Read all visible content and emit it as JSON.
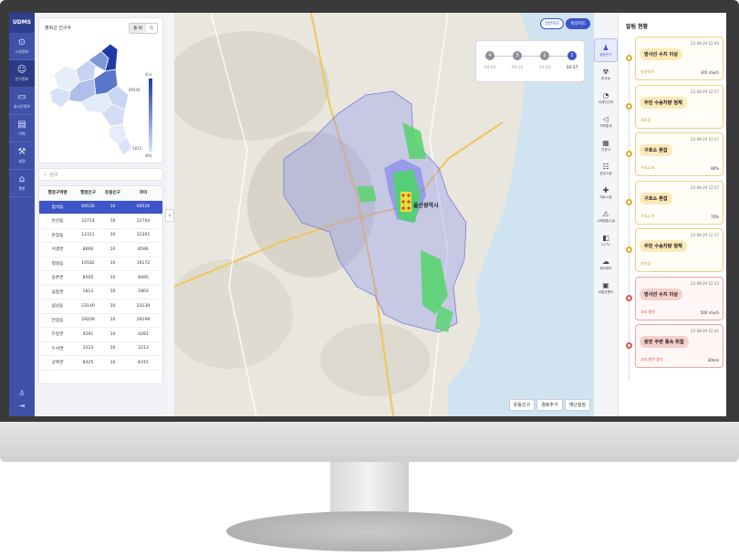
{
  "app": {
    "logo": "UDMS"
  },
  "nav": [
    {
      "icon": "map-pin-icon",
      "glyph": "⊙",
      "label": "시설정보"
    },
    {
      "icon": "person-icon",
      "glyph": "☺",
      "label": "인구정보"
    },
    {
      "icon": "monitor-icon",
      "glyph": "▭",
      "label": "실시간정보"
    },
    {
      "icon": "book-icon",
      "glyph": "▤",
      "label": "이력"
    },
    {
      "icon": "tools-icon",
      "glyph": "⚒",
      "label": "설정"
    },
    {
      "icon": "robot-icon",
      "glyph": "⌂",
      "label": "챗봇"
    }
  ],
  "population": {
    "title": "출퇴근 인구수",
    "toggle": [
      "출·퇴",
      "각"
    ],
    "legend_max_label": "최고",
    "legend_max": "69536",
    "legend_min": "1813",
    "legend_min_label": "최저"
  },
  "search": {
    "placeholder": "검색"
  },
  "table": {
    "headers": [
      "행정구역명",
      "행정인구",
      "유동인구",
      "차이"
    ],
    "rows": [
      [
        "범서읍",
        "69536",
        "10",
        "69526"
      ],
      [
        "온산읍",
        "22714",
        "10",
        "22704"
      ],
      [
        "온양읍",
        "12311",
        "10",
        "12301"
      ],
      [
        "서생면",
        "8606",
        "10",
        "8596"
      ],
      [
        "청량읍",
        "19182",
        "10",
        "19172"
      ],
      [
        "웅촌면",
        "8505",
        "10",
        "8495"
      ],
      [
        "삼동면",
        "1813",
        "10",
        "1803"
      ],
      [
        "삼남읍",
        "23140",
        "10",
        "23130"
      ],
      [
        "언양읍",
        "29209",
        "10",
        "29199"
      ],
      [
        "두동면",
        "4291",
        "10",
        "4281"
      ],
      [
        "두서면",
        "3223",
        "10",
        "3213"
      ],
      [
        "상북면",
        "8325",
        "10",
        "8315"
      ]
    ]
  },
  "map": {
    "basemap_buttons": [
      "일반지도",
      "위성지도"
    ],
    "city_label": "울산광역시",
    "timeline": [
      {
        "n": "4",
        "time": "09:03"
      },
      {
        "n": "3",
        "time": "09:32"
      },
      {
        "n": "2",
        "time": "10:03"
      },
      {
        "n": "1",
        "time": "10:37"
      }
    ],
    "bottom_buttons": [
      "유동인구",
      "경로추가",
      "재난설정"
    ]
  },
  "tools": [
    {
      "icon": "people-icon",
      "glyph": "♟",
      "label": "유동인구"
    },
    {
      "icon": "radiation-icon",
      "glyph": "☢",
      "label": "방사능"
    },
    {
      "icon": "gauge-icon",
      "glyph": "◔",
      "label": "이재민관리"
    },
    {
      "icon": "megaphone-icon",
      "glyph": "◁",
      "label": "지휘통제"
    },
    {
      "icon": "building-icon",
      "glyph": "▦",
      "label": "관공서"
    },
    {
      "icon": "group-icon",
      "glyph": "☷",
      "label": "공공시설"
    },
    {
      "icon": "hospital-icon",
      "glyph": "✚",
      "label": "의료시설"
    },
    {
      "icon": "hazard-icon",
      "glyph": "⚠",
      "label": "시해위험시설"
    },
    {
      "icon": "cctv-icon",
      "glyph": "◧",
      "label": "CCTV"
    },
    {
      "icon": "weather-icon",
      "glyph": "☁",
      "label": "위치정보"
    },
    {
      "icon": "car-icon",
      "glyph": "▣",
      "label": "교통흐름도"
    }
  ],
  "alerts": {
    "title": "알림 현황",
    "items": [
      {
        "time": "22-08-29 12:40",
        "title": "방사선 수치 이상",
        "location": "길지역 A",
        "value": "340 nSv/h",
        "level": "warn"
      },
      {
        "time": "22-08-29 12:37",
        "title": "주민 수송차량 정체",
        "location": "경로등",
        "value": "",
        "level": "warn"
      },
      {
        "time": "22-08-29 12:37",
        "title": "구호소 혼잡",
        "location": "구호소 B",
        "value": "80%",
        "level": "warn"
      },
      {
        "time": "22-08-29 12:37",
        "title": "구호소 혼잡",
        "location": "구호소 A",
        "value": "70%",
        "level": "warn"
      },
      {
        "time": "22-08-29 12:37",
        "title": "주민 수송차량 정체",
        "location": "지차량",
        "value": "",
        "level": "warn"
      },
      {
        "time": "22-08-29 12:33",
        "title": "방사선 수치 이상",
        "location": "고리 원전",
        "value": "500 nSv/h",
        "level": "danger"
      },
      {
        "time": "22-08-29 12:31",
        "title": "원전 주변 풍속 위험",
        "location": "고리 원전 풍속",
        "value": "30m/s",
        "level": "danger"
      }
    ]
  },
  "colors": {
    "nav": "#3f51a8",
    "accent": "#3d55c8",
    "warn": "#e2a93a",
    "danger": "#d9574a"
  }
}
